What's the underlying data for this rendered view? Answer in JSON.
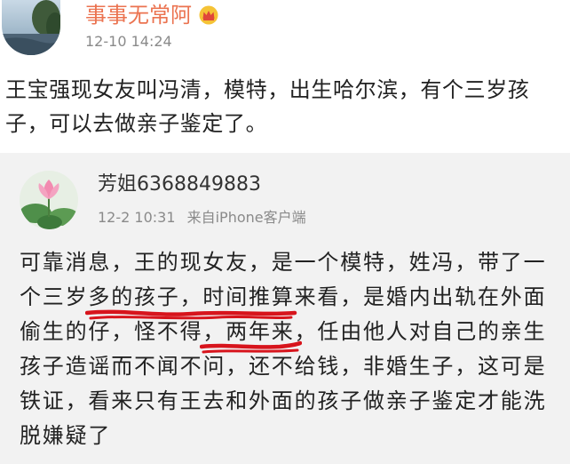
{
  "post": {
    "username": "事事无常阿",
    "timestamp": "12-10 14:24",
    "text": "王宝强现女友叫冯清，模特，出生哈尔滨，有个三岁孩子，可以去做亲子鉴定了。",
    "badge_icon": "crown-icon",
    "avatar_icon": "avatar-photo"
  },
  "repost": {
    "username": "芳姐6368849883",
    "timestamp": "12-2 10:31",
    "source": "来自iPhone客户端",
    "avatar_icon": "lotus-avatar",
    "text": "可靠消息，王的现女友，是一个模特，姓冯，带了一个三岁多的孩子，时间推算来看，是婚内出轨在外面偷生的仔，怪不得，两年来，任由他人对自己的亲生孩子造谣而不闻不问，还不给钱，非婚生子，这可是铁证，看来只有王去和外面的孩子做亲子鉴定才能洗脱嫌疑了"
  },
  "colors": {
    "username": "#eb7350",
    "meta": "#8a8a8a",
    "text": "#222222",
    "card_bg": "#f2f2f2",
    "annotation": "#d7141c"
  }
}
